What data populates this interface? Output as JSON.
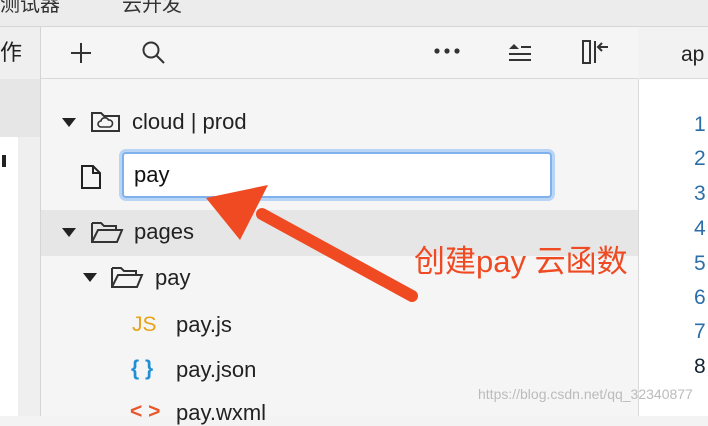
{
  "top_strip": {
    "left_text": "测试器",
    "right_text": "云开发"
  },
  "toolbar": {
    "menu_label": "作 ⌄",
    "add_icon": "plus-icon",
    "search_icon": "search-icon",
    "more_icon": "ellipsis-icon",
    "collapse_icon": "collapse-icon",
    "panel_icon": "panel-toggle-icon"
  },
  "tree": {
    "cloud_folder": "cloud | prod",
    "new_file_value": "pay",
    "pages_folder": "pages",
    "pay_folder": "pay",
    "files": [
      {
        "badge": "JS",
        "name": "pay.js"
      },
      {
        "badge": "{ }",
        "name": "pay.json"
      },
      {
        "badge": "< >",
        "name": "pay.wxml"
      }
    ]
  },
  "editor": {
    "tab_label": "ap",
    "line_numbers": [
      "1",
      "2",
      "3",
      "4",
      "5",
      "6",
      "7",
      "8"
    ]
  },
  "annotation": {
    "text": "创建pay 云函数",
    "color": "#f04a23"
  },
  "watermark": "https://blog.csdn.net/qq_32340877",
  "colors": {
    "input_focus": "#7fb2ec",
    "js_badge": "#e8a317",
    "json_badge": "#1f8fd6",
    "wxml_badge": "#e8572a"
  }
}
